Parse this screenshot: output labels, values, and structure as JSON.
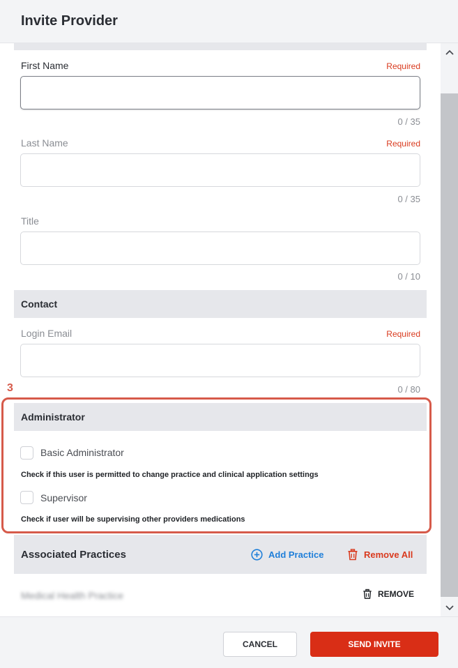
{
  "modal": {
    "title": "Invite Provider"
  },
  "fields": {
    "first_name": {
      "label": "First Name",
      "required": "Required",
      "value": "",
      "counter": "0 / 35"
    },
    "last_name": {
      "label": "Last Name",
      "required": "Required",
      "value": "",
      "counter": "0 / 35"
    },
    "title": {
      "label": "Title",
      "value": "",
      "counter": "0 / 10"
    }
  },
  "contact": {
    "section_title": "Contact",
    "login_email": {
      "label": "Login Email",
      "required": "Required",
      "value": "",
      "counter": "0 / 80"
    }
  },
  "annotation": {
    "number": "3"
  },
  "administrator": {
    "section_title": "Administrator",
    "basic_admin": {
      "label": "Basic Administrator",
      "checked": false,
      "help": "Check if this user is permitted to change practice and clinical application settings"
    },
    "supervisor": {
      "label": "Supervisor",
      "checked": false,
      "help": "Check if user will be supervising other providers medications"
    }
  },
  "practices": {
    "section_title": "Associated Practices",
    "add_label": "Add Practice",
    "remove_all_label": "Remove All",
    "items": [
      {
        "name": "Medical Health Practice",
        "remove_label": "REMOVE"
      }
    ]
  },
  "footer": {
    "cancel_label": "CANCEL",
    "send_label": "SEND INVITE"
  },
  "colors": {
    "accent_red": "#d92e16",
    "link_blue": "#1f7fd9",
    "annotation": "#d65a4a"
  },
  "icons": {
    "add": "plus-circle-icon",
    "remove_all": "trash-icon",
    "remove": "trash-icon",
    "scroll_up": "chevron-up-icon",
    "scroll_down": "chevron-down-icon"
  }
}
